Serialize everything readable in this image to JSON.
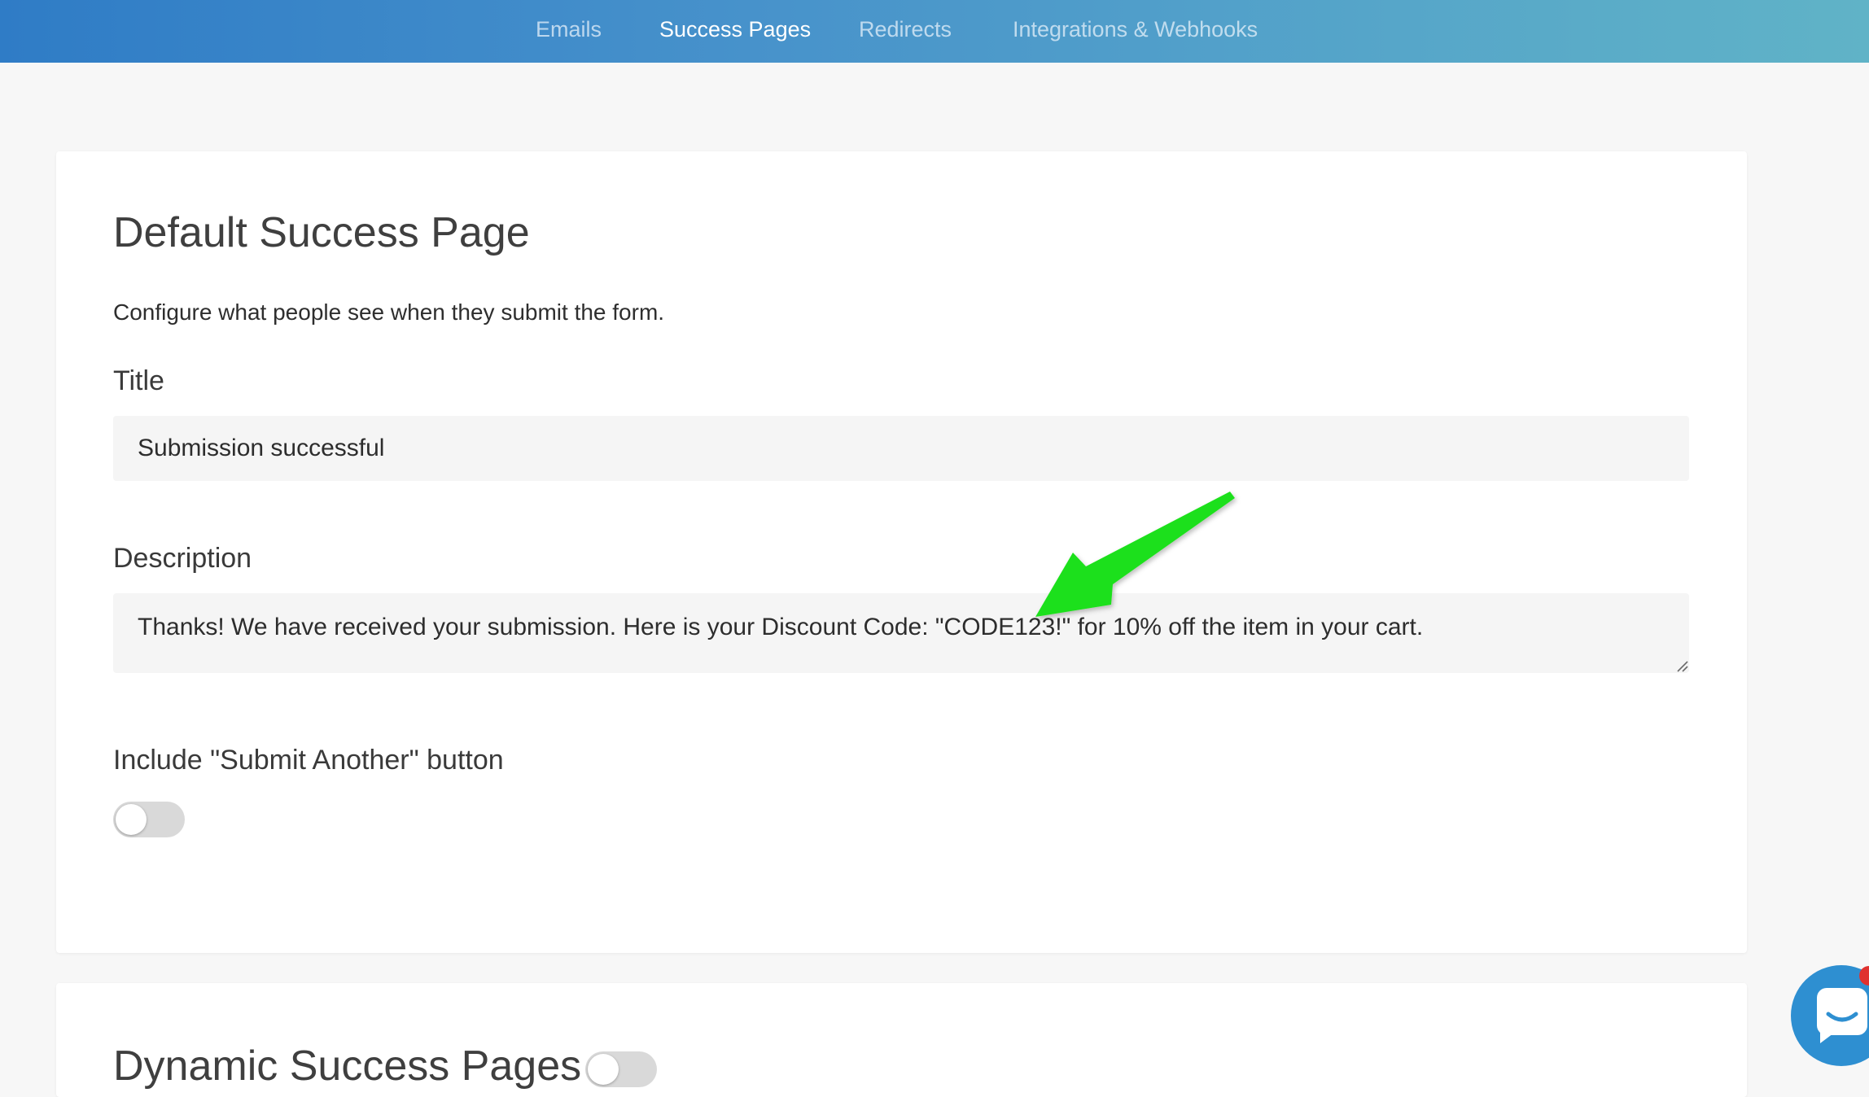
{
  "nav": {
    "items": [
      {
        "label": "Emails",
        "active": false
      },
      {
        "label": "Success Pages",
        "active": true
      },
      {
        "label": "Redirects",
        "active": false
      },
      {
        "label": "Integrations & Webhooks",
        "active": false
      }
    ]
  },
  "default_success": {
    "heading": "Default Success Page",
    "subtext": "Configure what people see when they submit the form.",
    "title_label": "Title",
    "title_value": "Submission successful",
    "description_label": "Description",
    "description_value": "Thanks! We have received your submission. Here is your Discount Code: \"CODE123!\" for 10% off the item in your cart.",
    "submit_another_label": "Include \"Submit Another\" button",
    "submit_another_enabled": false
  },
  "dynamic_success": {
    "heading": "Dynamic Success Pages",
    "enabled": false
  },
  "colors": {
    "accent_gradient_start": "#2f7cc6",
    "accent_gradient_end": "#60b3c7",
    "annotation_arrow": "#1fe01a",
    "chat_button": "#2e8fd1",
    "chat_badge": "#e0322f"
  },
  "icons": {
    "annotation": "arrow-annotation-icon",
    "chat": "chat-bubble-icon"
  }
}
